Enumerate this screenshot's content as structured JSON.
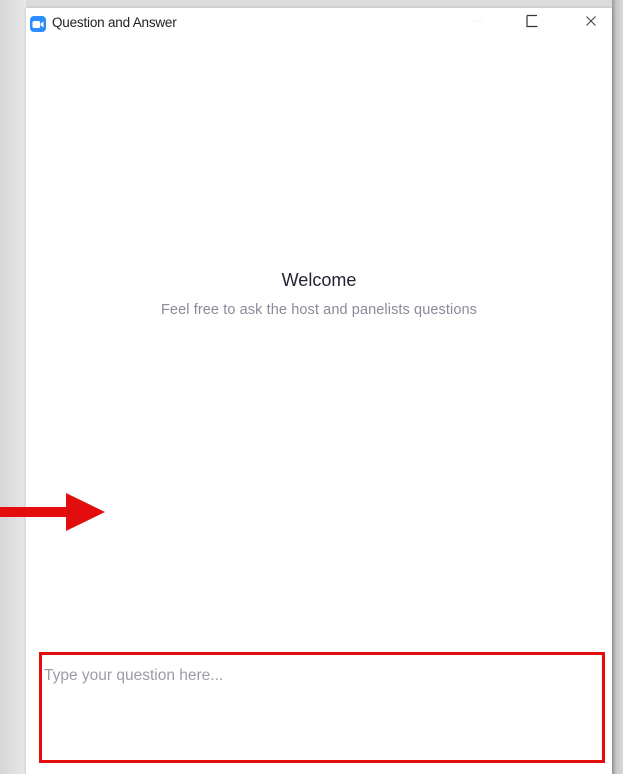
{
  "window": {
    "title": "Question and Answer",
    "app_icon": "zoom-camera-icon",
    "accent_color": "#2d8cff",
    "controls": [
      "minimize-icon",
      "maximize-icon",
      "close-icon"
    ]
  },
  "main": {
    "welcome_heading": "Welcome",
    "welcome_subtitle": "Feel free to ask the host and panelists questions"
  },
  "question_input": {
    "value": "",
    "placeholder": "Type your question here..."
  },
  "annotations": {
    "color": "#e30d0d",
    "arrow": "arrow-right-icon",
    "highlight": "highlight-box"
  }
}
